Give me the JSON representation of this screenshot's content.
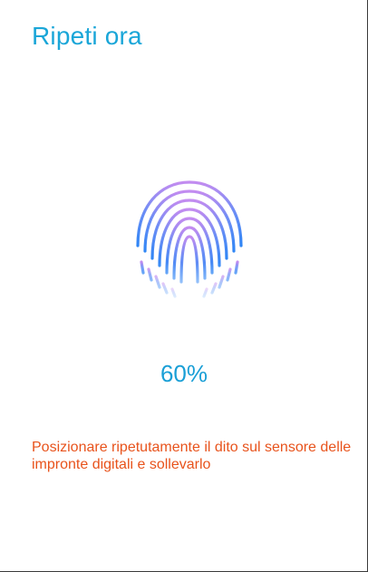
{
  "header": {
    "title": "Ripeti ora"
  },
  "enrollment": {
    "progress_text": "60%",
    "progress_value": 60,
    "instruction": "Posizionare ripetutamente il dito sul sensore delle impronte digitali e sollevarlo",
    "fingerprint_icon": "fingerprint-icon"
  },
  "colors": {
    "title": "#1aa6d8",
    "progress": "#1a9fd6",
    "instruction": "#e8531c",
    "fingerprint_top": "#c38cf0",
    "fingerprint_bottom": "#2f86f5"
  }
}
